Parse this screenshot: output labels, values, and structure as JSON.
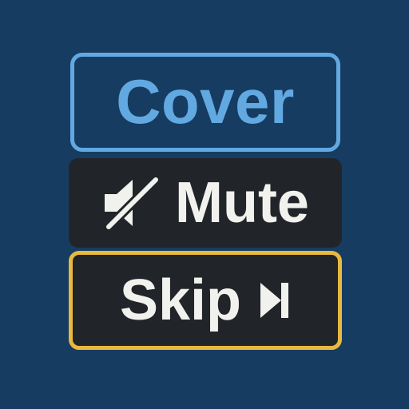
{
  "buttons": {
    "cover": {
      "label": "Cover",
      "border_color": "#62a9e2",
      "text_color": "#62a9e2"
    },
    "mute": {
      "label": "Mute",
      "icon": "speaker-muted-icon",
      "background": "#212529",
      "text_color": "#f1f1ee"
    },
    "skip": {
      "label": "Skip",
      "icon": "skip-next-icon",
      "border_color": "#e8b93e",
      "background": "#212529",
      "text_color": "#f1f1ee"
    }
  },
  "colors": {
    "page_background": "#173c62"
  }
}
